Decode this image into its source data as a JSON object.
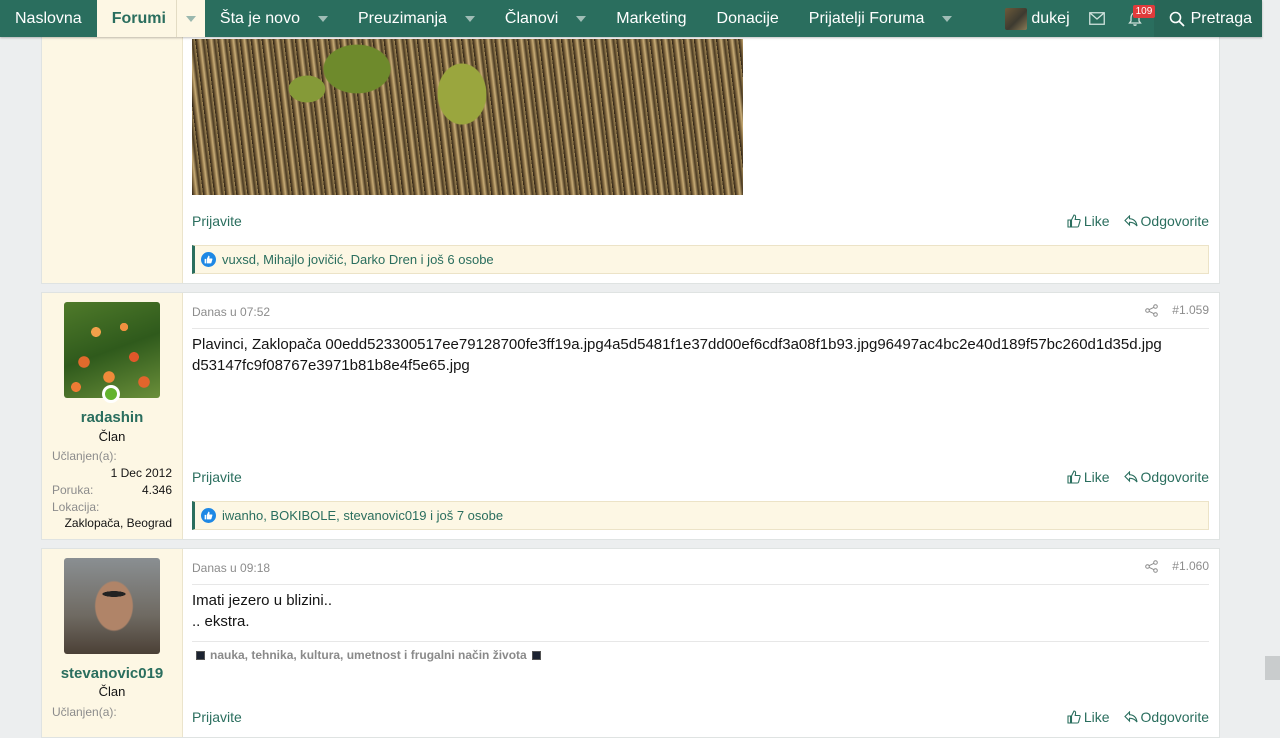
{
  "nav": {
    "items": [
      {
        "label": "Naslovna",
        "dropdown": false
      },
      {
        "label": "Forumi",
        "dropdown": true,
        "active": true
      },
      {
        "label": "Šta je novo",
        "dropdown": true
      },
      {
        "label": "Preuzimanja",
        "dropdown": true
      },
      {
        "label": "Članovi",
        "dropdown": true
      },
      {
        "label": "Marketing",
        "dropdown": false
      },
      {
        "label": "Donacije",
        "dropdown": false
      },
      {
        "label": "Prijatelji Foruma",
        "dropdown": true
      }
    ],
    "username": "dukej",
    "alerts_count": "109",
    "search_label": "Pretraga",
    "accent": "#2a6e5e"
  },
  "post_prev": {
    "report_label": "Prijavite",
    "like_label": "Like",
    "reply_label": "Odgovorite",
    "reactions": "vuxsd, Mihajlo jovičić, Darko Dren i još 6 osobe"
  },
  "post_1059": {
    "user": {
      "name": "radashin",
      "role": "Član",
      "joined_label": "Učlanjen(a):",
      "joined": "1 Dec 2012",
      "posts_label": "Poruka:",
      "posts": "4.346",
      "location_label": "Lokacija:",
      "location": "Zaklopača, Beograd"
    },
    "date": "Danas u 07:52",
    "number": "#1.059",
    "text_line1": "Plavinci, Zaklopača 00edd523300517ee79128700fe3ff19a.jpg4a5d5481f1e37dd00ef6cdf3a08f1b93.jpg96497ac4bc2e40d189f57bc260d1d35d.jpg",
    "text_line2": "d53147fc9f08767e3971b81b8e4f5e65.jpg",
    "report_label": "Prijavite",
    "like_label": "Like",
    "reply_label": "Odgovorite",
    "reactions": "iwanho, BOKIBOLE, stevanovic019 i još 7 osobe"
  },
  "post_1060": {
    "user": {
      "name": "stevanovic019",
      "role": "Član",
      "joined_label": "Učlanjen(a):"
    },
    "date": "Danas u 09:18",
    "number": "#1.060",
    "text_line1": "Imati jezero u blizini..",
    "text_line2": ".. ekstra.",
    "signature": "nauka, tehnika, kultura, umetnost i frugalni način života",
    "report_label": "Prijavite",
    "like_label": "Like",
    "reply_label": "Odgovorite"
  }
}
